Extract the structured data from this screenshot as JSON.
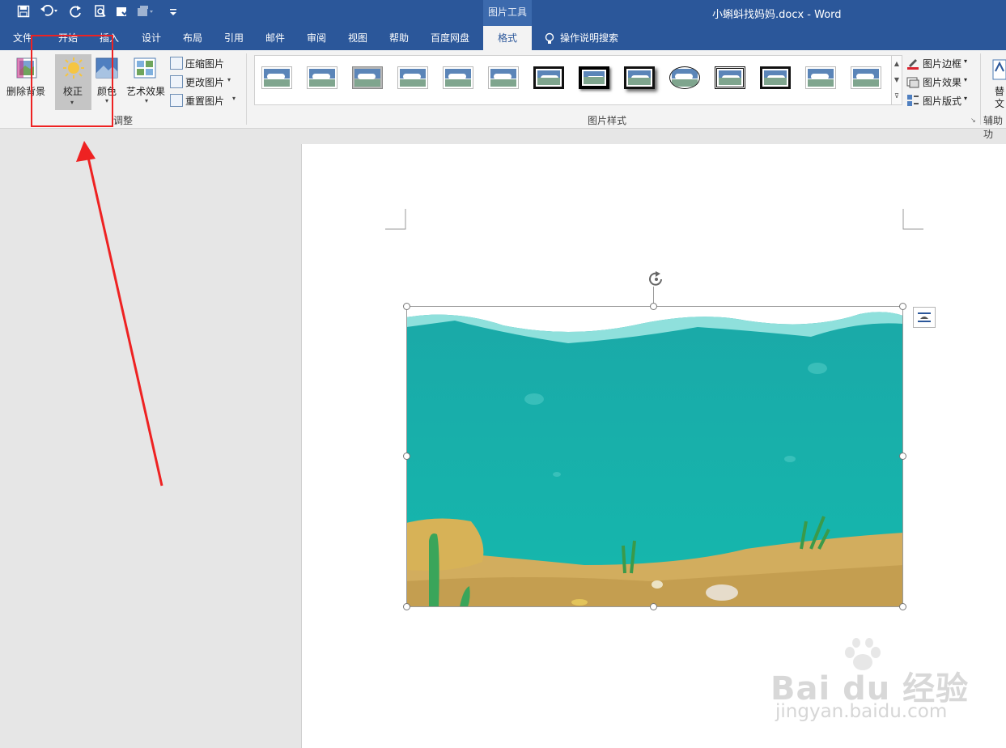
{
  "titlebar": {
    "context_tab_group": "图片工具",
    "document_title": "小蝌蚪找妈妈.docx  -  Word",
    "quick_access": [
      "save-icon",
      "undo-icon",
      "redo-icon",
      "print-preview-icon",
      "touch-mode-icon",
      "customize-icon"
    ]
  },
  "tabs": [
    "文件",
    "开始",
    "插入",
    "设计",
    "布局",
    "引用",
    "邮件",
    "审阅",
    "视图",
    "帮助",
    "百度网盘",
    "格式"
  ],
  "tell_me": "操作说明搜索",
  "ribbon": {
    "adjust": {
      "remove_bg": "删除背景",
      "corrections": "校正",
      "color": "颜色",
      "artistic": "艺术效果",
      "compress": "压缩图片",
      "change": "更改图片",
      "reset": "重置图片",
      "group_label": "调整"
    },
    "styles": {
      "group_label": "图片样式",
      "border": "图片边框",
      "effects": "图片效果",
      "layout": "图片版式"
    },
    "accessibility": {
      "alt_text_top": "替",
      "alt_text_bottom": "文",
      "group_label": "辅助功"
    }
  },
  "watermark": {
    "brand": "Bai  du 经验",
    "url": "jingyan.baidu.com"
  },
  "colors": {
    "title_blue": "#2b579a",
    "highlight_red": "#ee2222",
    "water": "#18b5ac"
  }
}
